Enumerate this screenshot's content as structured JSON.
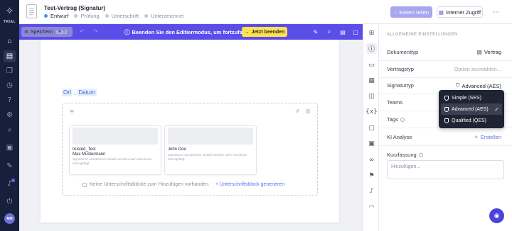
{
  "brand": {
    "glyph": "✧",
    "label": "TRIAL"
  },
  "document": {
    "title": "Test-Vertrag (Signatur)",
    "steps": [
      "Entwurf",
      "Prüfung",
      "Unterschrift",
      "Unterzeichnet"
    ]
  },
  "header": {
    "share_label": "Extern teilen",
    "access_label": "Interner Zugriff",
    "more_glyph": "⋯"
  },
  "editor_bar": {
    "save_label": "Speichern",
    "save_shortcut": "⌘ S",
    "banner": "Beenden Sie den Editiermodus, um fortzufahren.",
    "end_label": "Jetzt beenden"
  },
  "page": {
    "fields": [
      "Ort",
      "Datum"
    ],
    "separator": ",",
    "signature_cards": [
      {
        "line1": "trusted_Test",
        "line2": "Max Mustermann",
        "note": "Signaturort ausstehend. Details werden nach Abschluss hinzugefügt."
      },
      {
        "line1": "John Doe",
        "line2": "",
        "note": "Signaturort ausstehend. Details werden nach Abschluss hinzugefügt."
      }
    ],
    "empty_text": "Keine Unterschriftsblöcke zum Hinzufügen vorhanden.",
    "add_label": "Unterschriftsblock generieren"
  },
  "panel": {
    "heading": "ALLGEMEINE EINSTELLUNGEN",
    "rows": [
      {
        "label": "Dokumenttyp",
        "value": "Vertrag"
      },
      {
        "label": "Vertragstyp",
        "value": "Option auswählen..."
      },
      {
        "label": "Signaturtyp",
        "value": "Advanced (AES)"
      },
      {
        "label": "Teams",
        "value": ""
      },
      {
        "label": "Tags",
        "value": ""
      },
      {
        "label": "KI Analyse",
        "value": "Erstellen"
      }
    ],
    "summary_label": "Kurzfassung",
    "summary_placeholder": "Hinzufügen..."
  },
  "dropdown": {
    "options": [
      {
        "label": "Simple (SES)",
        "selected": false
      },
      {
        "label": "Advanced (AES)",
        "selected": true
      },
      {
        "label": "Qualified (QES)",
        "selected": false
      }
    ],
    "check": "✓"
  },
  "icons": {
    "nav": [
      "home-icon",
      "document-icon",
      "documents-icon",
      "clock-icon",
      "help-circle-icon",
      "settings-icon",
      "search-icon",
      "gift-icon",
      "notes-icon",
      "bell-icon",
      "logout-icon"
    ],
    "strip": [
      "layout-icon",
      "info-icon",
      "contact-card-icon",
      "calendar-icon",
      "book-icon",
      "variable-icon",
      "chat-icon",
      "archive-icon",
      "link-icon",
      "flag-icon",
      "bell-icon",
      "rss-icon"
    ]
  },
  "user": {
    "initials": "MM"
  }
}
